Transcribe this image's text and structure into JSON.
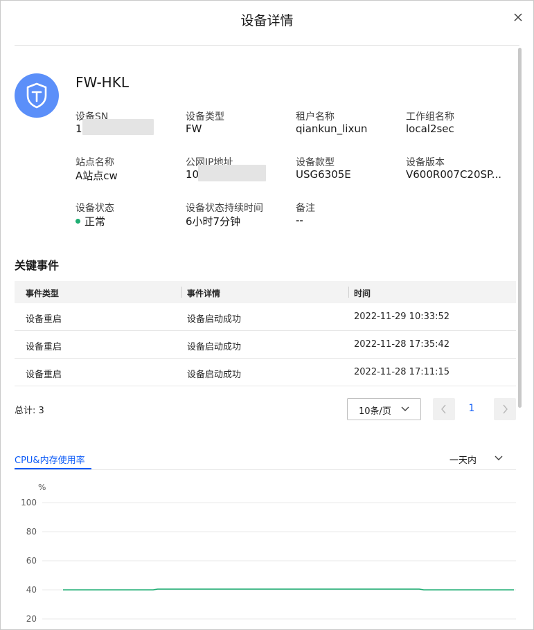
{
  "dialog": {
    "title": "设备详情"
  },
  "device": {
    "name": "FW-HKL",
    "attributes": [
      {
        "label": "设备SN",
        "value": "1"
      },
      {
        "label": "设备类型",
        "value": "FW"
      },
      {
        "label": "租户名称",
        "value": "qiankun_lixun"
      },
      {
        "label": "工作组名称",
        "value": "local2sec"
      },
      {
        "label": "站点名称",
        "value": "A站点cw"
      },
      {
        "label": "公网IP地址",
        "value": "10"
      },
      {
        "label": "设备款型",
        "value": "USG6305E"
      },
      {
        "label": "设备版本",
        "value": "V600R007C20SP..."
      },
      {
        "label": "设备状态",
        "value": "正常"
      },
      {
        "label": "设备状态持续时间",
        "value": "6小时7分钟"
      },
      {
        "label": "备注",
        "value": "--"
      }
    ],
    "status_color": "#1fae73"
  },
  "events": {
    "title": "关键事件",
    "columns": [
      "事件类型",
      "事件详情",
      "时间"
    ],
    "rows": [
      [
        "设备重启",
        "设备启动成功",
        "2022-11-29 10:33:52"
      ],
      [
        "设备重启",
        "设备启动成功",
        "2022-11-28 17:35:42"
      ],
      [
        "设备重启",
        "设备启动成功",
        "2022-11-28 17:11:15"
      ]
    ]
  },
  "pagination": {
    "total": "总计: 3",
    "page_size": "10条/页",
    "current_page": "1"
  },
  "usage": {
    "tab": "CPU&内存使用率",
    "range": "一天内",
    "accent": "#0a59f7"
  },
  "chart_data": {
    "type": "line",
    "ylabel": "%",
    "y_ticks": [
      "100",
      "80",
      "60",
      "40",
      "20"
    ],
    "ylim": [
      20,
      100
    ],
    "grid": true,
    "series": [
      {
        "color": "#1fae73",
        "points": [
          [
            0,
            40
          ],
          [
            0.2,
            40
          ],
          [
            0.21,
            40.5
          ],
          [
            0.79,
            40.5
          ],
          [
            0.8,
            40
          ],
          [
            1,
            40
          ]
        ]
      }
    ]
  }
}
